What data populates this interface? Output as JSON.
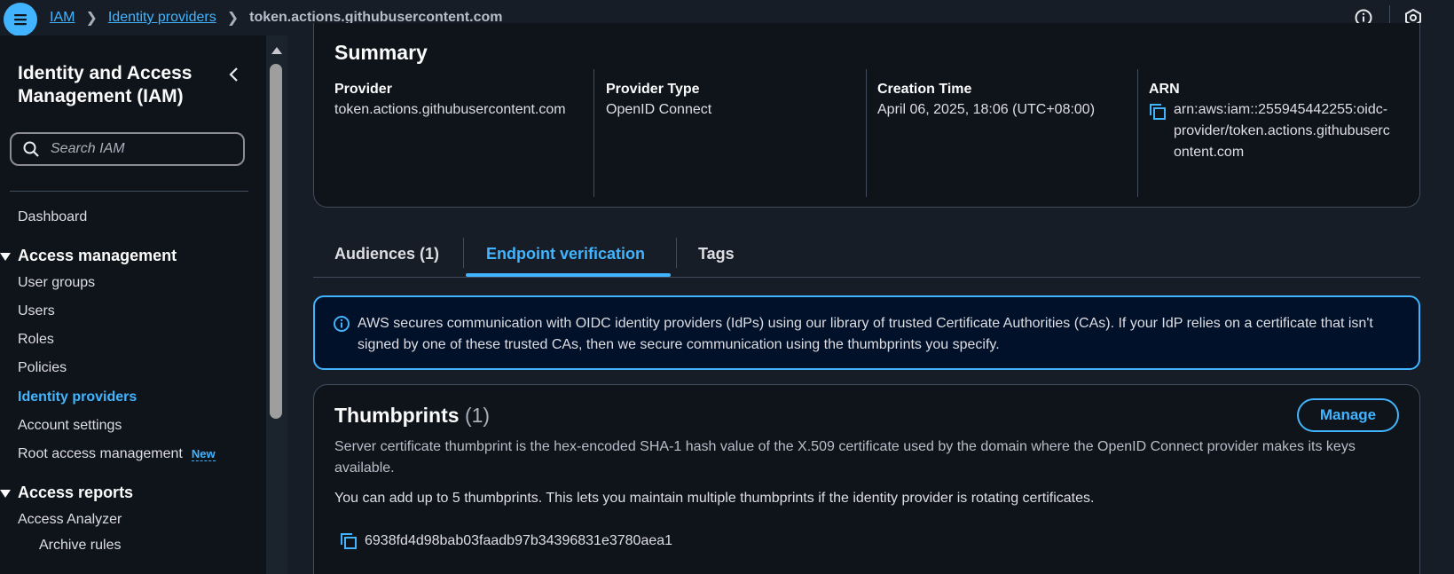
{
  "topbar": {
    "breadcrumbs": [
      "IAM",
      "Identity providers"
    ],
    "current": "token.actions.githubusercontent.com"
  },
  "sidebar": {
    "title": "Identity and Access Management (IAM)",
    "search_placeholder": "Search IAM",
    "dashboard": "Dashboard",
    "access_management": {
      "label": "Access management",
      "items": [
        "User groups",
        "Users",
        "Roles",
        "Policies",
        "Identity providers",
        "Account settings",
        "Root access management"
      ],
      "active": "Identity providers",
      "new_badge": "New"
    },
    "access_reports": {
      "label": "Access reports",
      "items": [
        "Access Analyzer"
      ],
      "sub_items": [
        "Archive rules"
      ]
    }
  },
  "summary": {
    "title": "Summary",
    "provider_label": "Provider",
    "provider_value": "token.actions.githubusercontent.com",
    "provider_type_label": "Provider Type",
    "provider_type_value": "OpenID Connect",
    "creation_time_label": "Creation Time",
    "creation_time_value": "April 06, 2025, 18:06 (UTC+08:00)",
    "arn_label": "ARN",
    "arn_value": "arn:aws:iam::255945442255:oidc-provider/token.actions.githubusercontent.com"
  },
  "tabs": [
    {
      "label": "Audiences (1)",
      "active": false
    },
    {
      "label": "Endpoint verification",
      "active": true
    },
    {
      "label": "Tags",
      "active": false
    }
  ],
  "info": {
    "text": "AWS secures communication with OIDC identity providers (IdPs) using our library of trusted Certificate Authorities (CAs). If your IdP relies on a certificate that isn't signed by one of these trusted CAs, then we secure communication using the thumbprints you specify."
  },
  "thumbprints": {
    "title": "Thumbprints",
    "count": "(1)",
    "manage_label": "Manage",
    "description": "Server certificate thumbprint is the hex-encoded SHA-1 hash value of the X.509 certificate used by the domain where the OpenID Connect provider makes its keys available.",
    "note": "You can add up to 5 thumbprints. This lets you maintain multiple thumbprints if the identity provider is rotating certificates.",
    "items": [
      "6938fd4d98bab03faadb97b34396831e3780aea1"
    ]
  },
  "colors": {
    "accent": "#42b4ff",
    "background": "#161d26",
    "sidebar": "#0f141a",
    "info_bg": "#001129"
  }
}
